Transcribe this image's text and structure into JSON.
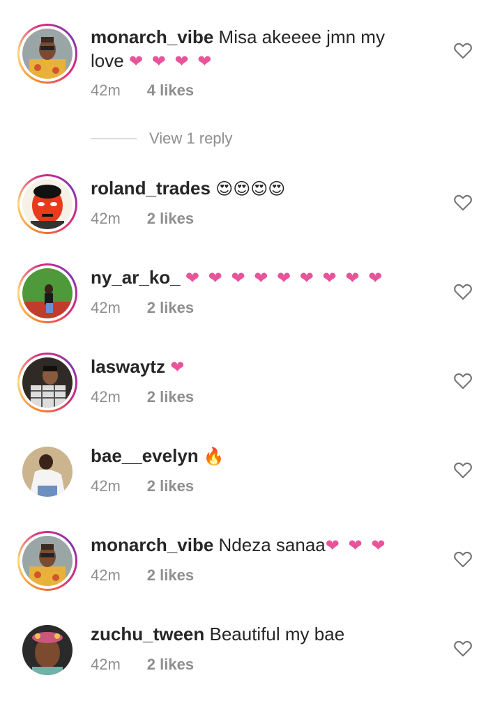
{
  "comments": [
    {
      "username": "monarch_vibe",
      "text": "Misa akeeee jmn my love",
      "emoji": "❤ ❤ ❤ ❤",
      "time": "42m",
      "likes": "4 likes",
      "ring": true,
      "avatar": "man-yellow"
    },
    {
      "username": "roland_trades",
      "text": "",
      "emoji": "😍😍😍😍",
      "time": "42m",
      "likes": "2 likes",
      "ring": true,
      "avatar": "red-face"
    },
    {
      "username": "ny_ar_ko_",
      "text": "",
      "emoji": "❤ ❤ ❤ ❤ ❤ ❤ ❤ ❤ ❤",
      "time": "42m",
      "likes": "2 likes",
      "ring": true,
      "avatar": "green-field"
    },
    {
      "username": "laswaytz",
      "text": "",
      "emoji": "❤",
      "time": "42m",
      "likes": "2 likes",
      "ring": true,
      "avatar": "man-plaid"
    },
    {
      "username": "bae__evelyn",
      "text": "",
      "emoji": "🔥",
      "time": "42m",
      "likes": "2 likes",
      "ring": false,
      "avatar": "woman-white"
    },
    {
      "username": "monarch_vibe",
      "text": "Ndeza sanaa",
      "emoji": "❤ ❤ ❤",
      "time": "42m",
      "likes": "2 likes",
      "ring": true,
      "avatar": "man-yellow"
    },
    {
      "username": "zuchu_tween",
      "text": "Beautiful my bae",
      "emoji": "",
      "time": "42m",
      "likes": "2 likes",
      "ring": false,
      "avatar": "woman-crown"
    }
  ],
  "view_replies": "View 1 reply",
  "colors": {
    "heart": "#e8549a",
    "meta": "#8e8e8e",
    "username": "#262626"
  }
}
